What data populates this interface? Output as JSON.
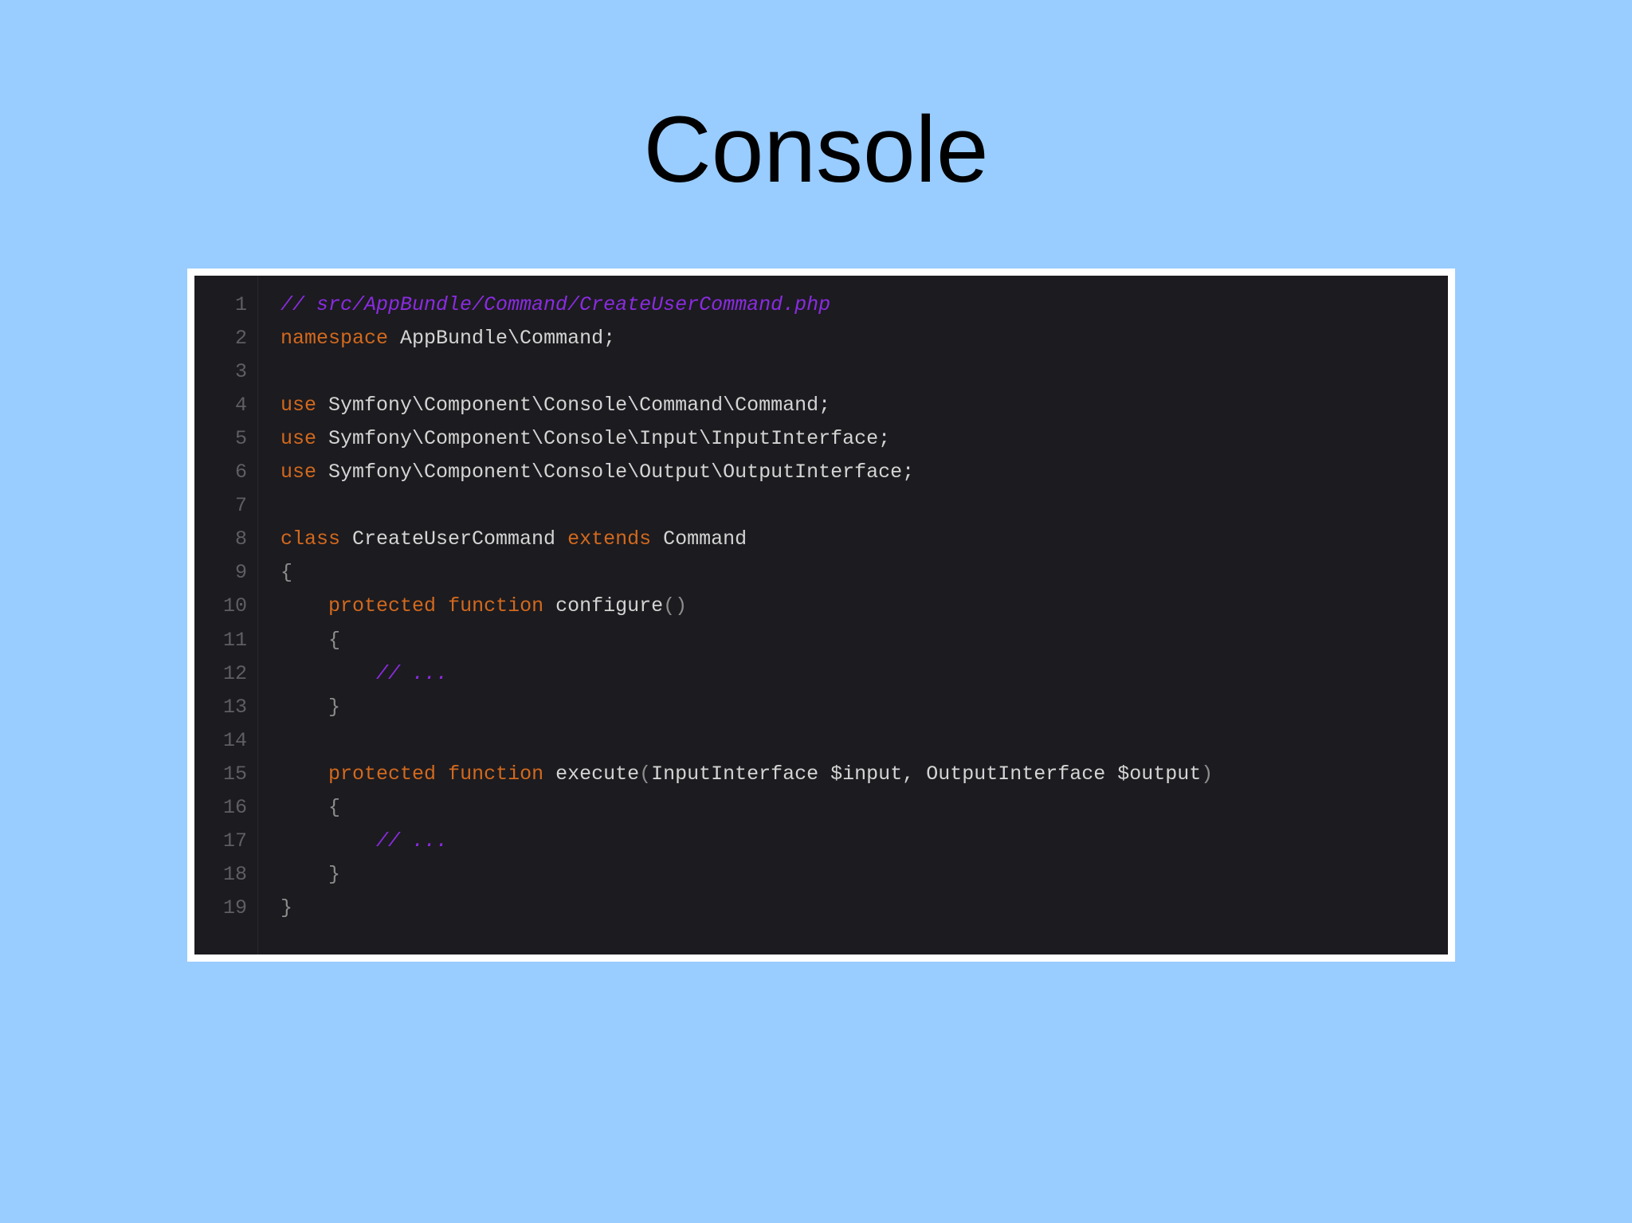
{
  "slide": {
    "title": "Console"
  },
  "colors": {
    "background": "#99ccff",
    "frame": "#ffffff",
    "editor_background": "#1c1b1f",
    "comment": "#8a2be2",
    "keyword": "#d2691e",
    "text": "#d4d4d4",
    "line_number": "#5f5e63"
  },
  "code": {
    "language": "php",
    "lines": [
      {
        "number": "1",
        "tokens": [
          {
            "type": "comment",
            "text": "// src/AppBundle/Command/CreateUserCommand.php"
          }
        ]
      },
      {
        "number": "2",
        "tokens": [
          {
            "type": "keyword",
            "text": "namespace"
          },
          {
            "type": "text",
            "text": " AppBundle\\Command;"
          }
        ]
      },
      {
        "number": "3",
        "tokens": []
      },
      {
        "number": "4",
        "tokens": [
          {
            "type": "keyword",
            "text": "use"
          },
          {
            "type": "text",
            "text": " Symfony\\Component\\Console\\Command\\Command;"
          }
        ]
      },
      {
        "number": "5",
        "tokens": [
          {
            "type": "keyword",
            "text": "use"
          },
          {
            "type": "text",
            "text": " Symfony\\Component\\Console\\Input\\InputInterface;"
          }
        ]
      },
      {
        "number": "6",
        "tokens": [
          {
            "type": "keyword",
            "text": "use"
          },
          {
            "type": "text",
            "text": " Symfony\\Component\\Console\\Output\\OutputInterface;"
          }
        ]
      },
      {
        "number": "7",
        "tokens": []
      },
      {
        "number": "8",
        "tokens": [
          {
            "type": "keyword",
            "text": "class"
          },
          {
            "type": "text",
            "text": " CreateUserCommand "
          },
          {
            "type": "keyword",
            "text": "extends"
          },
          {
            "type": "text",
            "text": " Command"
          }
        ]
      },
      {
        "number": "9",
        "tokens": [
          {
            "type": "punct",
            "text": "{"
          }
        ]
      },
      {
        "number": "10",
        "tokens": [
          {
            "type": "text",
            "text": "    "
          },
          {
            "type": "keyword",
            "text": "protected"
          },
          {
            "type": "text",
            "text": " "
          },
          {
            "type": "keyword",
            "text": "function"
          },
          {
            "type": "text",
            "text": " configure"
          },
          {
            "type": "punct",
            "text": "()"
          }
        ]
      },
      {
        "number": "11",
        "tokens": [
          {
            "type": "punct",
            "text": "    {"
          }
        ]
      },
      {
        "number": "12",
        "tokens": [
          {
            "type": "text",
            "text": "        "
          },
          {
            "type": "comment",
            "text": "// ..."
          }
        ]
      },
      {
        "number": "13",
        "tokens": [
          {
            "type": "punct",
            "text": "    }"
          }
        ]
      },
      {
        "number": "14",
        "tokens": []
      },
      {
        "number": "15",
        "tokens": [
          {
            "type": "text",
            "text": "    "
          },
          {
            "type": "keyword",
            "text": "protected"
          },
          {
            "type": "text",
            "text": " "
          },
          {
            "type": "keyword",
            "text": "function"
          },
          {
            "type": "text",
            "text": " execute"
          },
          {
            "type": "punct",
            "text": "("
          },
          {
            "type": "text",
            "text": "InputInterface $input, OutputInterface $output"
          },
          {
            "type": "punct",
            "text": ")"
          }
        ]
      },
      {
        "number": "16",
        "tokens": [
          {
            "type": "punct",
            "text": "    {"
          }
        ]
      },
      {
        "number": "17",
        "tokens": [
          {
            "type": "text",
            "text": "        "
          },
          {
            "type": "comment",
            "text": "// ..."
          }
        ]
      },
      {
        "number": "18",
        "tokens": [
          {
            "type": "punct",
            "text": "    }"
          }
        ]
      },
      {
        "number": "19",
        "tokens": [
          {
            "type": "punct",
            "text": "}"
          }
        ]
      }
    ]
  }
}
